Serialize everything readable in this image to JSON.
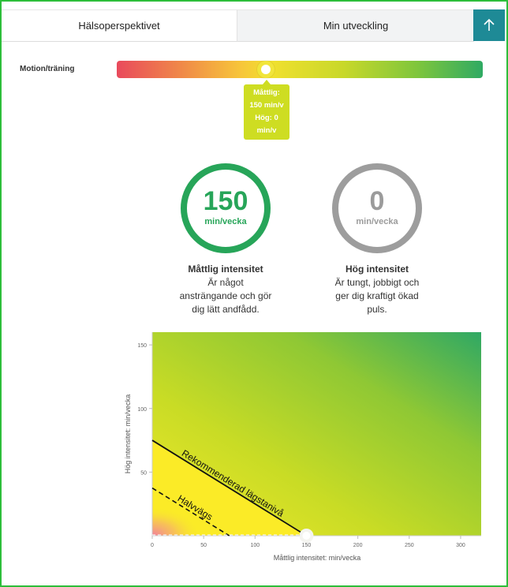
{
  "tabs": [
    {
      "label": "Hälsoperspektivet",
      "active": true
    },
    {
      "label": "Min utveckling",
      "active": false
    }
  ],
  "up_button": {
    "icon": "arrow-up-icon",
    "color": "#1e8a96"
  },
  "slider": {
    "label": "Motion/träning",
    "tooltip_lines": [
      "Måttlig:",
      "150 min/v",
      "Hög: 0",
      "min/v"
    ]
  },
  "moderate": {
    "value": "150",
    "unit": "min/vecka",
    "title": "Måttlig intensitet",
    "desc_lines": [
      "Är något",
      "ansträngande och gör",
      "dig lätt andfådd."
    ],
    "color": "#27a559"
  },
  "high": {
    "value": "0",
    "unit": "min/vecka",
    "title": "Hög intensitet",
    "desc_lines": [
      "Är tungt, jobbigt och",
      "ger dig kraftigt ökad",
      "puls."
    ],
    "color": "#9d9d9d"
  },
  "chart_data": {
    "type": "heatmap",
    "xlabel": "Måttlig intensitet: min/vecka",
    "ylabel": "Hög intensitet: min/vecka",
    "xlim": [
      0,
      320
    ],
    "ylim": [
      0,
      160
    ],
    "xticks": [
      0,
      50,
      100,
      150,
      200,
      250,
      300
    ],
    "yticks": [
      50,
      100,
      150
    ],
    "lines": [
      {
        "label": "Rekommenderad lägstanivå",
        "style": "solid",
        "x": [
          0,
          150
        ],
        "y": [
          75,
          0
        ]
      },
      {
        "label": "Halvvägs",
        "style": "dashed",
        "x": [
          0,
          75
        ],
        "y": [
          37.5,
          0
        ]
      }
    ],
    "point": {
      "x": 150,
      "y": 0
    }
  }
}
